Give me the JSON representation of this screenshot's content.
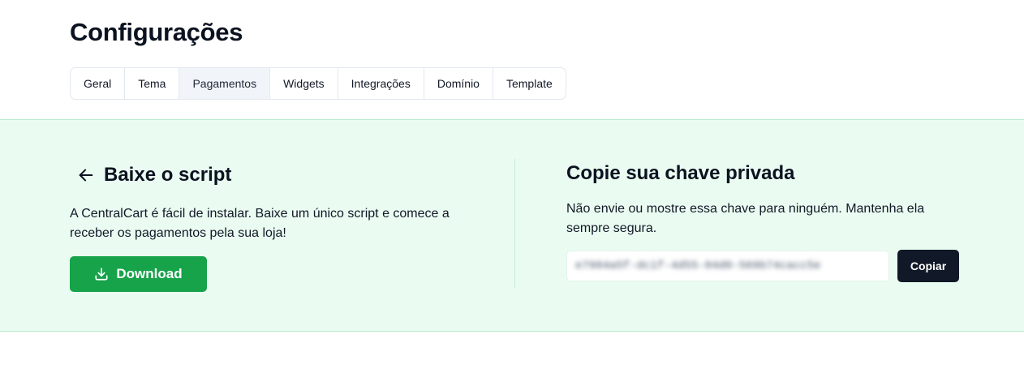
{
  "page": {
    "title": "Configurações"
  },
  "tabs": [
    {
      "label": "Geral",
      "active": false
    },
    {
      "label": "Tema",
      "active": false
    },
    {
      "label": "Pagamentos",
      "active": true
    },
    {
      "label": "Widgets",
      "active": false
    },
    {
      "label": "Integrações",
      "active": false
    },
    {
      "label": "Domínio",
      "active": false
    },
    {
      "label": "Template",
      "active": false
    }
  ],
  "script_section": {
    "title": "Baixe o script",
    "description": "A CentralCart é fácil de instalar. Baixe um único script e comece a receber os pagamentos pela sua loja!",
    "download_label": "Download",
    "back_icon": "arrow-left-icon",
    "download_icon": "download-icon"
  },
  "key_section": {
    "title": "Copie sua chave privada",
    "description": "Não envie ou mostre essa chave para ninguém. Mantenha ela sempre segura.",
    "key_value": "e7984a5f-dc1f-4d55-84d0-569b74cacc5e",
    "copy_label": "Copiar"
  },
  "colors": {
    "panel_bg": "#eafcf1",
    "download_button": "#16a34a",
    "copy_button": "#111827"
  }
}
